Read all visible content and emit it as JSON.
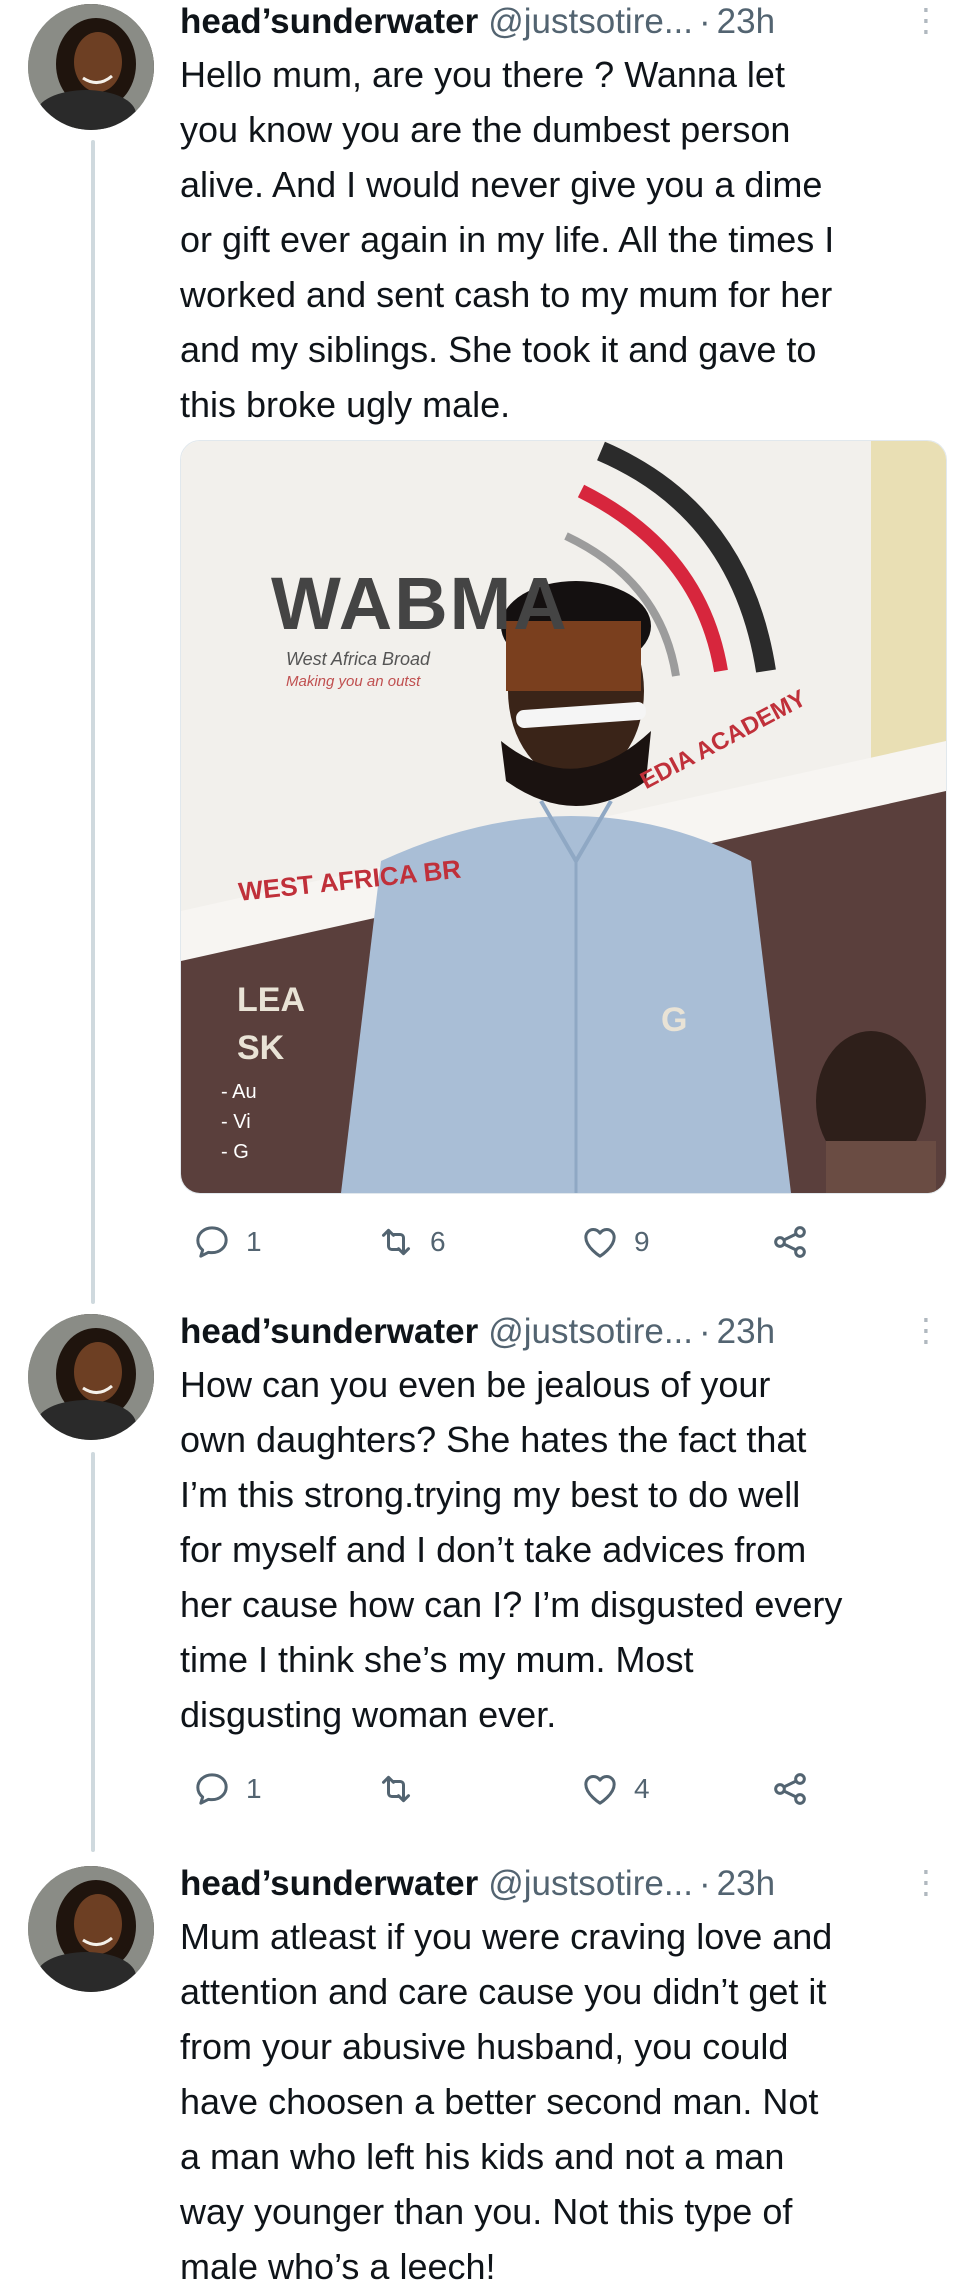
{
  "tweets": [
    {
      "author": {
        "name": "head’sunderwater",
        "handle": "@justsotire...",
        "separator": "·",
        "time": "23h"
      },
      "more_icon": "more-icon",
      "text": "Hello mum, are you there ? Wanna let\nyou know you are the dumbest person\nalive. And I would never give you a dime\nor gift ever again in my life. All the times I\nworked and sent cash to my mum for her\nand my siblings. She took it and gave to\nthis broke ugly male.",
      "media": {
        "banner_logo": "WABMA",
        "banner_tagline": "West Africa Broad",
        "banner_subtagline": "Making you an outst",
        "banner_arc_text": "EDIA ACADEMY",
        "banner_red_text": "WEST AFRICA BR",
        "banner_lines": [
          "LEA",
          "SK"
        ],
        "banner_list": [
          "- Au",
          "- Vi",
          "- G"
        ],
        "banner_letter": "G"
      },
      "actions": {
        "replies": "1",
        "retweets": "6",
        "likes": "9",
        "share": ""
      }
    },
    {
      "author": {
        "name": "head’sunderwater",
        "handle": "@justsotire...",
        "separator": "·",
        "time": "23h"
      },
      "more_icon": "more-icon",
      "text": "How can you even be jealous of your\nown daughters? She hates the fact that\nI’m this strong.trying my best to do well\nfor myself and I don’t take advices from\nher cause how can I? I’m disgusted every\ntime I think she’s my mum. Most\ndisgusting woman ever.",
      "actions": {
        "replies": "1",
        "retweets": "",
        "likes": "4",
        "share": ""
      }
    },
    {
      "author": {
        "name": "head’sunderwater",
        "handle": "@justsotire...",
        "separator": "·",
        "time": "23h"
      },
      "more_icon": "more-icon",
      "text": "Mum atleast if you were craving love and\nattention and care cause you didn’t get it\nfrom your abusive husband, you could\nhave choosen  a better second man. Not\na man who left his kids and not a man\nway younger than you. Not this type  of\nmale who’s a leech!"
    }
  ],
  "colors": {
    "text": "#0f1419",
    "secondary": "#536471",
    "thread_line": "#cfd9de",
    "brand_red": "#d7263d"
  }
}
